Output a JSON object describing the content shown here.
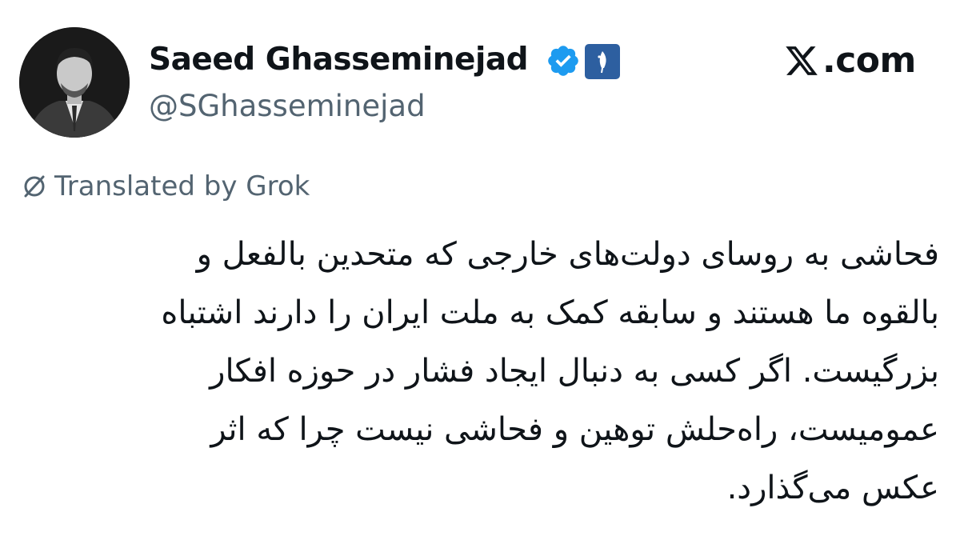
{
  "author": {
    "name": "Saeed Ghasseminejad",
    "handle": "@SGhasseminejad",
    "verified_icon": "verified-checkmark-icon",
    "affiliate_icon": "affiliate-badge-icon"
  },
  "source": {
    "logo_icon": "x-logo-icon",
    "domain": ".com"
  },
  "translation": {
    "icon": "translate-icon",
    "label": "Translated by Grok"
  },
  "tweet": {
    "lines": [
      "فحاشی به روسای دولت‌های خارجی که متحدین بالفعل و",
      "بالقوه ما هستند و سابقه کمک به ملت ایران را دارند اشتباه",
      "بزرگیست. اگر کسی به دنبال ایجاد فشار در حوزه افکار",
      "عمومیست، راه‌حلش توهین و فحاشی نیست چرا که اثر",
      "عکس می‌گذارد."
    ]
  },
  "colors": {
    "text": "#0f1419",
    "secondary": "#536471",
    "verified": "#1d9bf0",
    "affiliate": "#2d5fa0"
  }
}
